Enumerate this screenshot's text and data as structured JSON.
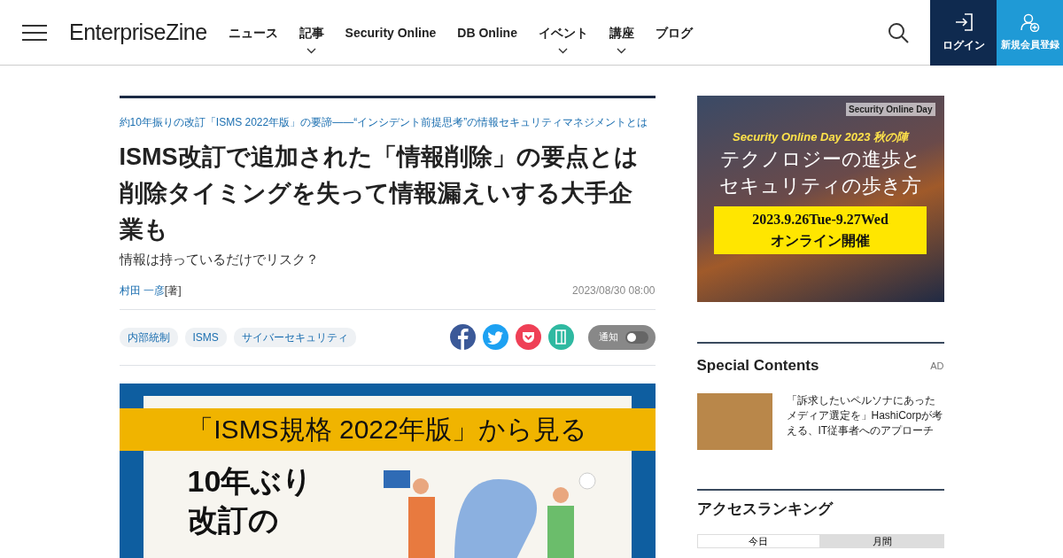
{
  "header": {
    "logo": "EnterpriseZine",
    "nav": [
      {
        "label": "ニュース",
        "dropdown": false
      },
      {
        "label": "記事",
        "dropdown": true
      },
      {
        "label": "Security Online",
        "dropdown": false
      },
      {
        "label": "DB Online",
        "dropdown": false
      },
      {
        "label": "イベント",
        "dropdown": true
      },
      {
        "label": "講座",
        "dropdown": true
      },
      {
        "label": "ブログ",
        "dropdown": false
      }
    ],
    "login": "ログイン",
    "register": "新規会員登録"
  },
  "article": {
    "series": "約10年振りの改訂「ISMS 2022年版」の要諦――“インシデント前提思考”の情報セキュリティマネジメントとは",
    "title_lines": [
      "ISMS改訂で追加された「情報削除」の要点とは",
      "削除タイミングを失って情報漏えいする大手企業も"
    ],
    "subtitle": "情報は持っているだけでリスク？",
    "author": "村田 一彦",
    "author_role": "[著]",
    "date": "2023/08/30 08:00",
    "tags": [
      "内部統制",
      "ISMS",
      "サイバーセキュリティ"
    ],
    "share": [
      {
        "kind": "facebook",
        "color": "#3b5998"
      },
      {
        "kind": "twitter",
        "color": "#1da1f2"
      },
      {
        "kind": "pocket",
        "color": "#ef4056"
      },
      {
        "kind": "bookmark",
        "color": "#2fb9a1"
      }
    ],
    "notify": {
      "label": "通知",
      "on": false
    },
    "hero": {
      "banner": "「ISMS規格 2022年版」から見る",
      "lines": [
        "10年ぶり",
        "改訂の"
      ]
    }
  },
  "sidebar": {
    "ad_banner": {
      "logo": "Security Online Day",
      "event": "Security Online Day 2023 秋の陣",
      "headline": [
        "テクノロジーの進歩と",
        "セキュリティの歩き方"
      ],
      "dates": "2023.9.26Tue-9.27Wed",
      "venue": "オンライン開催"
    },
    "special": {
      "heading": "Special Contents",
      "ad_label": "AD",
      "items": [
        {
          "text": "「訴求したいペルソナにあったメディア選定を」HashiCorpが考える、IT従事者へのアプローチ"
        }
      ]
    },
    "ranking": {
      "heading": "アクセスランキング",
      "tabs": [
        {
          "label": "今日",
          "selected": true
        },
        {
          "label": "月間",
          "selected": false
        }
      ]
    }
  }
}
